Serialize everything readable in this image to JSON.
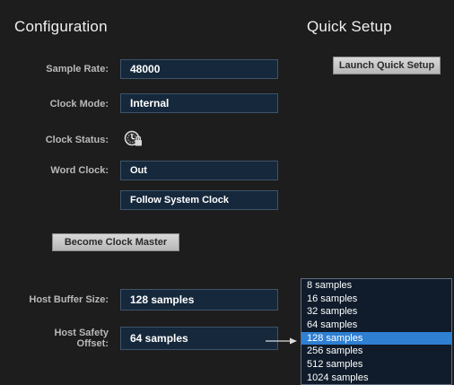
{
  "configuration": {
    "title": "Configuration",
    "sample_rate": {
      "label": "Sample Rate:",
      "value": "48000"
    },
    "clock_mode": {
      "label": "Clock Mode:",
      "value": "Internal"
    },
    "clock_status": {
      "label": "Clock Status:",
      "icon": "clock-locked-icon"
    },
    "word_clock": {
      "label": "Word Clock:",
      "value": "Out",
      "secondary_value": "Follow System Clock"
    },
    "become_clock_master_label": "Become Clock Master",
    "host_buffer_size": {
      "label": "Host Buffer Size:",
      "value": "128 samples"
    },
    "host_safety_offset": {
      "label_line1": "Host Safety",
      "label_line2": "Offset:",
      "value": "64 samples"
    }
  },
  "quick_setup": {
    "title": "Quick Setup",
    "launch_label": "Launch Quick Setup"
  },
  "buffer_dropdown": {
    "options": [
      "8 samples",
      "16 samples",
      "32 samples",
      "64 samples",
      "128 samples",
      "256 samples",
      "512 samples",
      "1024 samples"
    ],
    "selected": "128 samples"
  },
  "colors": {
    "background": "#1d1d1d",
    "field_bg": "#16283b",
    "selection": "#2f7fd3"
  }
}
